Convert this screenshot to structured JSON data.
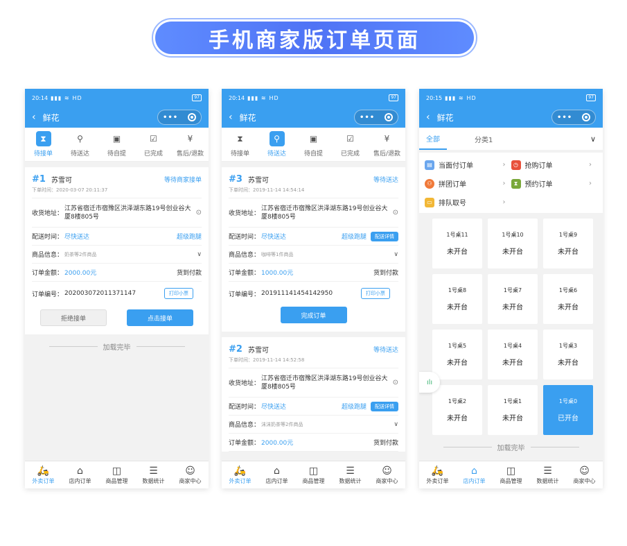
{
  "banner": {
    "title": "手机商家版订单页面"
  },
  "phones": [
    {
      "status": {
        "time": "20:14",
        "signal": "HD",
        "battery": "97"
      },
      "nav": {
        "back": "‹",
        "title": "鲜花"
      },
      "tabs": [
        "待接单",
        "待送达",
        "待自提",
        "已完成",
        "售后/退款"
      ],
      "order": {
        "num": "#1",
        "name": "苏雪可",
        "status": "等待商家接单",
        "time": "下单时间：2020-03-07 20:11:37",
        "addr_label": "收货地址：",
        "addr": "江苏省宿迁市宿豫区洪泽湖东路19号创业谷大厦8楼805号",
        "delivery_label": "配送时间：",
        "delivery": "尽快送达",
        "delivery_right": "超级跑腿",
        "goods_label": "商品信息：",
        "goods": "奶茶等2件商品",
        "amount_label": "订单金额：",
        "amount": "2000.00元",
        "pay": "货到付款",
        "no_label": "订单编号：",
        "no": "202003072011371147",
        "print": "打印小票",
        "reject": "拒绝接单",
        "accept": "点击接单"
      },
      "loaded": "加载完毕",
      "bottom": [
        "外卖订单",
        "店内订单",
        "商品管理",
        "数据统计",
        "商家中心"
      ]
    },
    {
      "status": {
        "time": "20:14",
        "signal": "HD",
        "battery": "97"
      },
      "nav": {
        "back": "‹",
        "title": "鲜花"
      },
      "tabs": [
        "待接单",
        "待送达",
        "待自提",
        "已完成",
        "售后/退款"
      ],
      "orders": [
        {
          "num": "#3",
          "name": "苏雪可",
          "status": "等待送达",
          "time": "下单时间：2019-11-14 14:54:14",
          "addr_label": "收货地址：",
          "addr": "江苏省宿迁市宿豫区洪泽湖东路19号创业谷大厦8楼805号",
          "delivery_label": "配送时间：",
          "delivery": "尽快送达",
          "delivery_right": "超级跑腿",
          "detail": "配送详情",
          "goods_label": "商品信息：",
          "goods": "咖啡等1件商品",
          "amount_label": "订单金额：",
          "amount": "1000.00元",
          "pay": "货到付款",
          "no_label": "订单编号：",
          "no": "201911141454142950",
          "print": "打印小票",
          "finish": "完成订单"
        },
        {
          "num": "#2",
          "name": "苏雪可",
          "status": "等待送达",
          "time": "下单时间：2019-11-14 14:52:58",
          "addr_label": "收货地址：",
          "addr": "江苏省宿迁市宿豫区洪泽湖东路19号创业谷大厦8楼805号",
          "delivery_label": "配送时间：",
          "delivery": "尽快送达",
          "delivery_right": "超级跑腿",
          "detail": "配送详情",
          "goods_label": "商品信息：",
          "goods": "沫沫奶茶等2件商品",
          "amount_label": "订单金额：",
          "amount": "2000.00元",
          "pay": "货到付款"
        }
      ],
      "bottom": [
        "外卖订单",
        "店内订单",
        "商品管理",
        "数据统计",
        "商家中心"
      ]
    },
    {
      "status": {
        "time": "20:15",
        "signal": "HD",
        "battery": "97"
      },
      "nav": {
        "back": "‹",
        "title": "鲜花"
      },
      "cats": [
        "全部",
        "分类1"
      ],
      "menu": [
        "当面付订单",
        "抢购订单",
        "拼团订单",
        "预约订单",
        "排队取号"
      ],
      "tables": [
        {
          "name": "1号桌11",
          "status": "未开台"
        },
        {
          "name": "1号桌10",
          "status": "未开台"
        },
        {
          "name": "1号桌9",
          "status": "未开台"
        },
        {
          "name": "1号桌8",
          "status": "未开台"
        },
        {
          "name": "1号桌7",
          "status": "未开台"
        },
        {
          "name": "1号桌6",
          "status": "未开台"
        },
        {
          "name": "1号桌5",
          "status": "未开台"
        },
        {
          "name": "1号桌4",
          "status": "未开台"
        },
        {
          "name": "1号桌3",
          "status": "未开台"
        },
        {
          "name": "1号桌2",
          "status": "未开台"
        },
        {
          "name": "1号桌1",
          "status": "未开台"
        },
        {
          "name": "1号桌0",
          "status": "已开台"
        }
      ],
      "loaded": "加载完毕",
      "bottom": [
        "外卖订单",
        "店内订单",
        "商品管理",
        "数据统计",
        "商家中心"
      ]
    }
  ],
  "colors": {
    "primary": "#3a9ff0",
    "banner": "#4f73f5"
  }
}
